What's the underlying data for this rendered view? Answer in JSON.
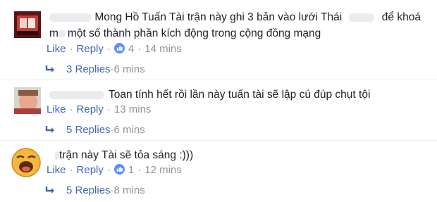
{
  "comments": [
    {
      "text_line1": "Mong Hồ Tuấn Tài trận này ghi 3 bản vào lưới Thái",
      "text_line1_tail": "để khoá",
      "text_line1_prefix": "m",
      "text_line2": "một số thành phần kích động trong cộng đồng mạng",
      "like_label": "Like",
      "reply_label": "Reply",
      "reaction_count": "4",
      "time": "14 mins",
      "replies_label": "3 Replies",
      "replies_time": "6 mins"
    },
    {
      "text_line1": "Toan tính hết rồi lần này tuấn tài sẽ lập cú đúp chụt tội",
      "like_label": "Like",
      "reply_label": "Reply",
      "time": "13 mins",
      "replies_label": "5 Replies",
      "replies_time": "6 mins"
    },
    {
      "text_line1": "trận này Tài sẽ tỏa sáng :)))",
      "like_label": "Like",
      "reply_label": "Reply",
      "reaction_count": "1",
      "time": "12 mins",
      "replies_label": "5 Replies",
      "replies_time": "8 mins"
    }
  ],
  "colors": {
    "link": "#4267b2",
    "meta": "#90949c",
    "text": "#1d2129",
    "like_blue": "#5890ff"
  }
}
